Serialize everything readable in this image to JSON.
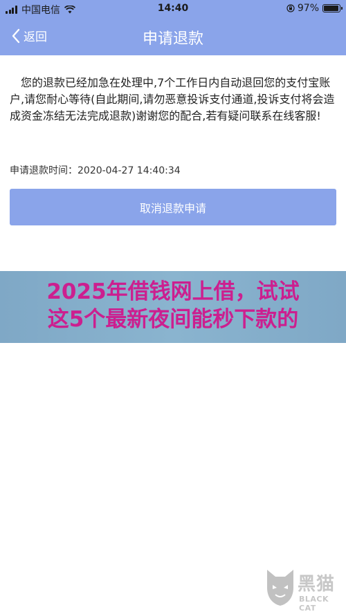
{
  "status_bar": {
    "carrier": "中国电信",
    "time": "14:40",
    "battery": "97%",
    "battery_level": 0.97
  },
  "nav": {
    "back_label": "返回",
    "title": "申请退款"
  },
  "main": {
    "message": "您的退款已经加急在处理中,7个工作日内自动退回您的支付宝账户,请您耐心等待(自此期间,请勿恶意投诉支付通道,投诉支付将会造成资金冻结无法完成退款)谢谢您的配合,若有疑问联系在线客服!",
    "time_label": "申请退款时间：",
    "time_value": "2020-04-27 14:40:34",
    "cancel_button": "取消退款申请"
  },
  "banner": {
    "line1": "2025年借钱网上借，试试",
    "line2": "这5个最新夜间能秒下款的"
  },
  "watermark": {
    "cn": "黑猫",
    "en": "BLACK CAT"
  },
  "colors": {
    "header": "#8aa4ea",
    "button": "#8aa4ea",
    "banner_text": "#cc1f8f"
  }
}
